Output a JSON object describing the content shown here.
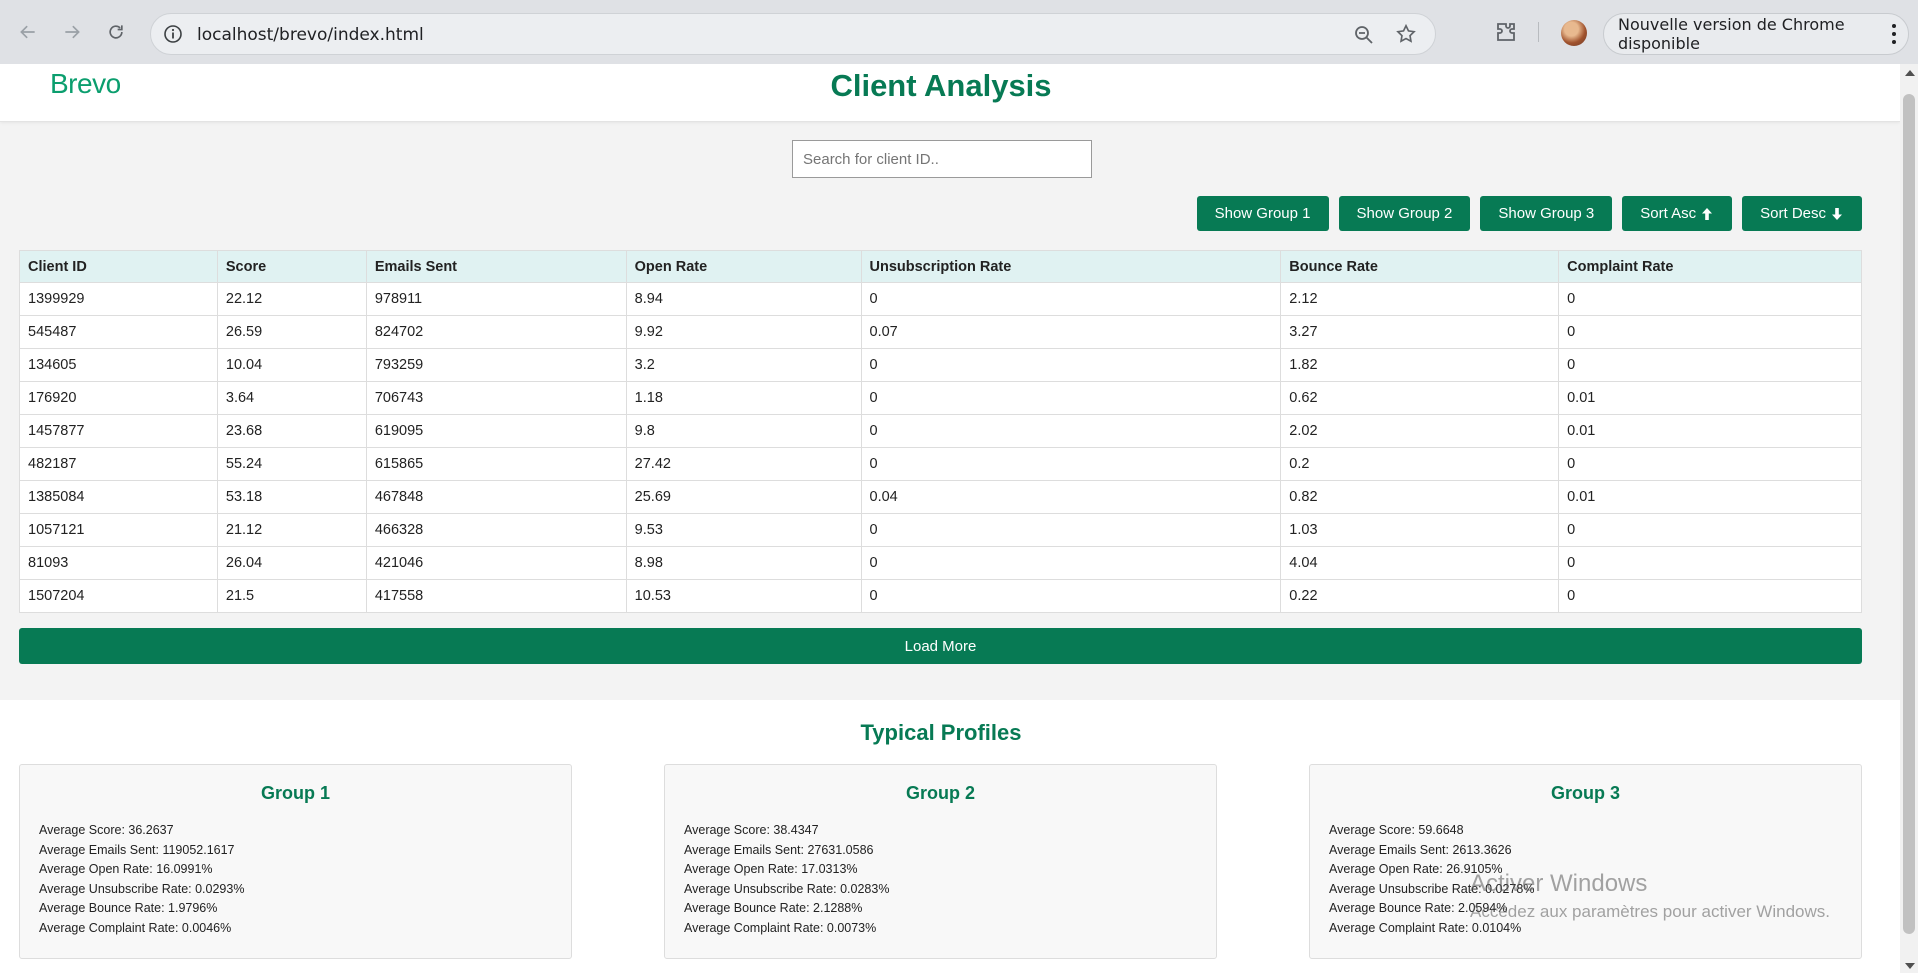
{
  "browser": {
    "url": "localhost/brevo/index.html",
    "update_text": "Nouvelle version de Chrome disponible"
  },
  "app": {
    "logo": "Brevo",
    "title": "Client Analysis"
  },
  "search": {
    "placeholder": "Search for client ID..",
    "value": ""
  },
  "buttons": {
    "group1": "Show Group 1",
    "group2": "Show Group 2",
    "group3": "Show Group 3",
    "sort_asc": "Sort Asc",
    "sort_desc": "Sort Desc",
    "load_more": "Load More"
  },
  "table": {
    "headers": [
      "Client ID",
      "Score",
      "Emails Sent",
      "Open Rate",
      "Unsubscription Rate",
      "Bounce Rate",
      "Complaint Rate"
    ],
    "rows": [
      [
        "1399929",
        "22.12",
        "978911",
        "8.94",
        "0",
        "2.12",
        "0"
      ],
      [
        "545487",
        "26.59",
        "824702",
        "9.92",
        "0.07",
        "3.27",
        "0"
      ],
      [
        "134605",
        "10.04",
        "793259",
        "3.2",
        "0",
        "1.82",
        "0"
      ],
      [
        "176920",
        "3.64",
        "706743",
        "1.18",
        "0",
        "0.62",
        "0.01"
      ],
      [
        "1457877",
        "23.68",
        "619095",
        "9.8",
        "0",
        "2.02",
        "0.01"
      ],
      [
        "482187",
        "55.24",
        "615865",
        "27.42",
        "0",
        "0.2",
        "0"
      ],
      [
        "1385084",
        "53.18",
        "467848",
        "25.69",
        "0.04",
        "0.82",
        "0.01"
      ],
      [
        "1057121",
        "21.12",
        "466328",
        "9.53",
        "0",
        "1.03",
        "0"
      ],
      [
        "81093",
        "26.04",
        "421046",
        "8.98",
        "0",
        "4.04",
        "0"
      ],
      [
        "1507204",
        "21.5",
        "417558",
        "10.53",
        "0",
        "0.22",
        "0"
      ]
    ]
  },
  "profiles": {
    "title": "Typical Profiles",
    "groups": [
      {
        "name": "Group 1",
        "stats": [
          "Average Score: 36.2637",
          "Average Emails Sent: 119052.1617",
          "Average Open Rate: 16.0991%",
          "Average Unsubscribe Rate: 0.0293%",
          "Average Bounce Rate: 1.9796%",
          "Average Complaint Rate: 0.0046%"
        ]
      },
      {
        "name": "Group 2",
        "stats": [
          "Average Score: 38.4347",
          "Average Emails Sent: 27631.0586",
          "Average Open Rate: 17.0313%",
          "Average Unsubscribe Rate: 0.0283%",
          "Average Bounce Rate: 2.1288%",
          "Average Complaint Rate: 0.0073%"
        ]
      },
      {
        "name": "Group 3",
        "stats": [
          "Average Score: 59.6648",
          "Average Emails Sent: 2613.3626",
          "Average Open Rate: 26.9105%",
          "Average Unsubscribe Rate: 0.0278%",
          "Average Bounce Rate: 2.0594%",
          "Average Complaint Rate: 0.0104%"
        ]
      }
    ]
  },
  "watermark": {
    "line1": "Activer Windows",
    "line2": "Accédez aux paramètres pour activer Windows."
  },
  "colors": {
    "brand": "#077a54",
    "logo": "#0b9e6e",
    "table_header_bg": "#e0f2f2"
  }
}
